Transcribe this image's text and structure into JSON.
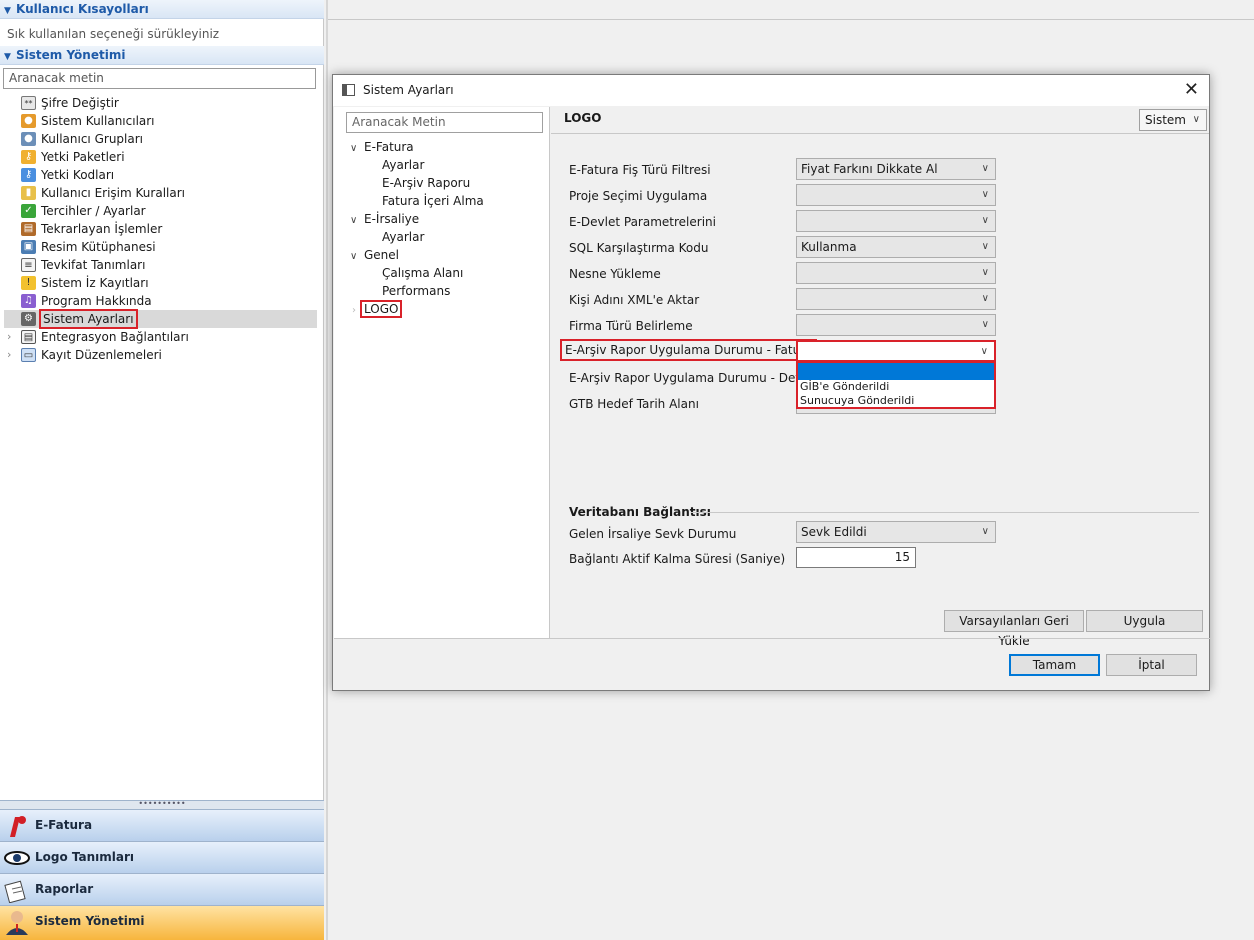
{
  "left_panel": {
    "shortcuts_header": "Kullanıcı Kısayolları",
    "shortcuts_hint": "Sık kullanılan seçeneği sürükleyiniz",
    "admin_header": "Sistem Yönetimi",
    "search_placeholder": "Aranacak metin",
    "items": [
      {
        "label": "Şifre Değiştir",
        "icon": "password-icon"
      },
      {
        "label": "Sistem Kullanıcıları",
        "icon": "users-icon"
      },
      {
        "label": "Kullanıcı Grupları",
        "icon": "user-groups-icon"
      },
      {
        "label": "Yetki Paketleri",
        "icon": "key-icon"
      },
      {
        "label": "Yetki Kodları",
        "icon": "key-icon"
      },
      {
        "label": "Kullanıcı Erişim Kuralları",
        "icon": "access-rules-icon"
      },
      {
        "label": "Tercihler / Ayarlar",
        "icon": "preferences-icon"
      },
      {
        "label": "Tekrarlayan İşlemler",
        "icon": "recurring-icon"
      },
      {
        "label": "Resim Kütüphanesi",
        "icon": "image-library-icon"
      },
      {
        "label": "Tevkifat Tanımları",
        "icon": "withholding-icon"
      },
      {
        "label": "Sistem İz Kayıtları",
        "icon": "audit-icon"
      },
      {
        "label": "Program Hakkında",
        "icon": "music-note-icon"
      },
      {
        "label": "Sistem Ayarları",
        "icon": "gear-icon"
      },
      {
        "label": "Entegrasyon Bağlantıları",
        "icon": "integration-icon"
      },
      {
        "label": "Kayıt Düzenlemeleri",
        "icon": "record-edit-icon"
      }
    ],
    "bottom_modules": [
      {
        "label": "E-Fatura",
        "icon": "efatura-icon"
      },
      {
        "label": "Logo Tanımları",
        "icon": "eye-icon"
      },
      {
        "label": "Raporlar",
        "icon": "reports-icon"
      },
      {
        "label": "Sistem Yönetimi",
        "icon": "admin-user-icon"
      }
    ]
  },
  "dialog": {
    "title": "Sistem Ayarları",
    "tree_search_placeholder": "Aranacak Metin",
    "tree": {
      "efatura": "E-Fatura",
      "efatura_children": [
        "Ayarlar",
        "E-Arşiv Raporu",
        "Fatura İçeri Alma"
      ],
      "eirsaliye": "E-İrsaliye",
      "eirsaliye_children": [
        "Ayarlar"
      ],
      "genel": "Genel",
      "genel_children": [
        "Çalışma Alanı",
        "Performans"
      ],
      "logo": "LOGO"
    },
    "panel_title": "LOGO",
    "scope_select": "Sistem",
    "settings": [
      {
        "label": "E-Fatura Fiş Türü Filtresi",
        "value": "Fiyat Farkını Dikkate Al"
      },
      {
        "label": "Proje Seçimi Uygulama",
        "value": ""
      },
      {
        "label": "E-Devlet Parametrelerini",
        "value": ""
      },
      {
        "label": "SQL Karşılaştırma Kodu",
        "value": "Kullanma"
      },
      {
        "label": "Nesne Yükleme",
        "value": ""
      },
      {
        "label": "Kişi Adını XML'e Aktar",
        "value": ""
      },
      {
        "label": "Firma Türü Belirleme",
        "value": ""
      },
      {
        "label": "E-Arşiv Rapor Uygulama Durumu - Fatura",
        "value": ""
      },
      {
        "label": "E-Arşiv Rapor Uygulama Durumu - Detay",
        "value": ""
      },
      {
        "label": "GTB Hedef Tarih Alanı",
        "value": ""
      }
    ],
    "dropdown_options": [
      "GİB'e Gönderildi",
      "Sunucuya Gönderildi"
    ],
    "db_section_title": "Veritabanı Bağlantısı",
    "db_settings": {
      "irsaliye_label": "Gelen İrsaliye Sevk Durumu",
      "irsaliye_value": "Sevk Edildi",
      "timeout_label": "Bağlantı Aktif Kalma Süresi (Saniye)",
      "timeout_value": "15"
    },
    "buttons": {
      "restore_defaults": "Varsayılanları Geri Yükle",
      "apply": "Uygula",
      "ok": "Tamam",
      "cancel": "İptal"
    }
  },
  "colors": {
    "highlight_red": "#d9222a",
    "selection_blue": "#0078d7",
    "header_blue": "#1e5aa8",
    "active_module_orange": "#f7b53c"
  }
}
